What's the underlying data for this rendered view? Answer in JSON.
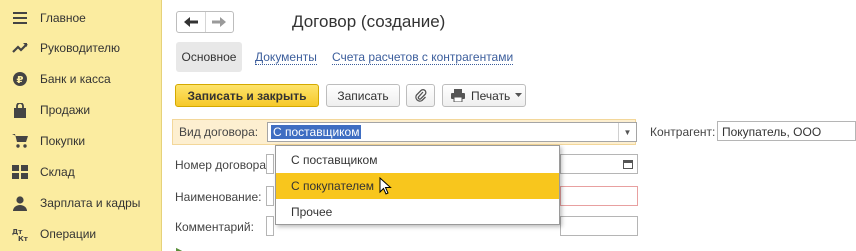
{
  "sidebar": {
    "items": [
      {
        "label": "Главное",
        "icon": "menu-icon"
      },
      {
        "label": "Руководителю",
        "icon": "trend-icon"
      },
      {
        "label": "Банк и касса",
        "icon": "coin-icon"
      },
      {
        "label": "Продажи",
        "icon": "bag-icon"
      },
      {
        "label": "Покупки",
        "icon": "cart-icon"
      },
      {
        "label": "Склад",
        "icon": "warehouse-icon"
      },
      {
        "label": "Зарплата и кадры",
        "icon": "person-icon"
      },
      {
        "label": "Операции",
        "icon": "dt-kt-icon"
      }
    ]
  },
  "header": {
    "title": "Договор (создание)",
    "back_glyph": "🡐",
    "forward_glyph": "🡒"
  },
  "tabs": {
    "main": "Основное",
    "documents": "Документы",
    "accounts": "Счета расчетов с контрагентами"
  },
  "toolbar": {
    "save_close": "Записать и закрыть",
    "save": "Записать",
    "print": "Печать",
    "attach_icon": "paperclip-icon",
    "print_icon": "printer-icon"
  },
  "form": {
    "contract_type_label": "Вид договора:",
    "contract_type_value": "С поставщиком",
    "counterparty_label": "Контрагент:",
    "counterparty_value": "Покупатель, ООО",
    "number_label": "Номер договора:",
    "name_label": "Наименование:",
    "comment_label": "Комментарий:"
  },
  "dropdown": {
    "options": [
      "С поставщиком",
      "С покупателем",
      "Прочее"
    ],
    "highlighted": "С покупателем"
  },
  "colors": {
    "sidebar_bg": "#fbeca0",
    "primary_button": "#f6c92a",
    "link": "#3c5e9c",
    "selection": "#3f6ec2",
    "highlight_row": "#fdefd0",
    "dropdown_active": "#f8c61d"
  }
}
